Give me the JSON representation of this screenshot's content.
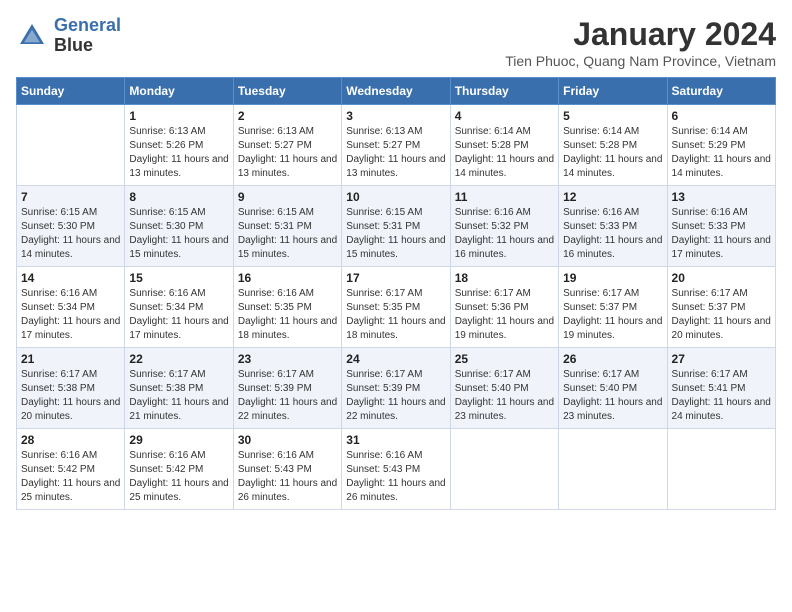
{
  "header": {
    "logo_line1": "General",
    "logo_line2": "Blue",
    "title": "January 2024",
    "subtitle": "Tien Phuoc, Quang Nam Province, Vietnam"
  },
  "calendar": {
    "weekdays": [
      "Sunday",
      "Monday",
      "Tuesday",
      "Wednesday",
      "Thursday",
      "Friday",
      "Saturday"
    ],
    "weeks": [
      [
        {
          "day": "",
          "sunrise": "",
          "sunset": "",
          "daylight": ""
        },
        {
          "day": "1",
          "sunrise": "Sunrise: 6:13 AM",
          "sunset": "Sunset: 5:26 PM",
          "daylight": "Daylight: 11 hours and 13 minutes."
        },
        {
          "day": "2",
          "sunrise": "Sunrise: 6:13 AM",
          "sunset": "Sunset: 5:27 PM",
          "daylight": "Daylight: 11 hours and 13 minutes."
        },
        {
          "day": "3",
          "sunrise": "Sunrise: 6:13 AM",
          "sunset": "Sunset: 5:27 PM",
          "daylight": "Daylight: 11 hours and 13 minutes."
        },
        {
          "day": "4",
          "sunrise": "Sunrise: 6:14 AM",
          "sunset": "Sunset: 5:28 PM",
          "daylight": "Daylight: 11 hours and 14 minutes."
        },
        {
          "day": "5",
          "sunrise": "Sunrise: 6:14 AM",
          "sunset": "Sunset: 5:28 PM",
          "daylight": "Daylight: 11 hours and 14 minutes."
        },
        {
          "day": "6",
          "sunrise": "Sunrise: 6:14 AM",
          "sunset": "Sunset: 5:29 PM",
          "daylight": "Daylight: 11 hours and 14 minutes."
        }
      ],
      [
        {
          "day": "7",
          "sunrise": "Sunrise: 6:15 AM",
          "sunset": "Sunset: 5:30 PM",
          "daylight": "Daylight: 11 hours and 14 minutes."
        },
        {
          "day": "8",
          "sunrise": "Sunrise: 6:15 AM",
          "sunset": "Sunset: 5:30 PM",
          "daylight": "Daylight: 11 hours and 15 minutes."
        },
        {
          "day": "9",
          "sunrise": "Sunrise: 6:15 AM",
          "sunset": "Sunset: 5:31 PM",
          "daylight": "Daylight: 11 hours and 15 minutes."
        },
        {
          "day": "10",
          "sunrise": "Sunrise: 6:15 AM",
          "sunset": "Sunset: 5:31 PM",
          "daylight": "Daylight: 11 hours and 15 minutes."
        },
        {
          "day": "11",
          "sunrise": "Sunrise: 6:16 AM",
          "sunset": "Sunset: 5:32 PM",
          "daylight": "Daylight: 11 hours and 16 minutes."
        },
        {
          "day": "12",
          "sunrise": "Sunrise: 6:16 AM",
          "sunset": "Sunset: 5:33 PM",
          "daylight": "Daylight: 11 hours and 16 minutes."
        },
        {
          "day": "13",
          "sunrise": "Sunrise: 6:16 AM",
          "sunset": "Sunset: 5:33 PM",
          "daylight": "Daylight: 11 hours and 17 minutes."
        }
      ],
      [
        {
          "day": "14",
          "sunrise": "Sunrise: 6:16 AM",
          "sunset": "Sunset: 5:34 PM",
          "daylight": "Daylight: 11 hours and 17 minutes."
        },
        {
          "day": "15",
          "sunrise": "Sunrise: 6:16 AM",
          "sunset": "Sunset: 5:34 PM",
          "daylight": "Daylight: 11 hours and 17 minutes."
        },
        {
          "day": "16",
          "sunrise": "Sunrise: 6:16 AM",
          "sunset": "Sunset: 5:35 PM",
          "daylight": "Daylight: 11 hours and 18 minutes."
        },
        {
          "day": "17",
          "sunrise": "Sunrise: 6:17 AM",
          "sunset": "Sunset: 5:35 PM",
          "daylight": "Daylight: 11 hours and 18 minutes."
        },
        {
          "day": "18",
          "sunrise": "Sunrise: 6:17 AM",
          "sunset": "Sunset: 5:36 PM",
          "daylight": "Daylight: 11 hours and 19 minutes."
        },
        {
          "day": "19",
          "sunrise": "Sunrise: 6:17 AM",
          "sunset": "Sunset: 5:37 PM",
          "daylight": "Daylight: 11 hours and 19 minutes."
        },
        {
          "day": "20",
          "sunrise": "Sunrise: 6:17 AM",
          "sunset": "Sunset: 5:37 PM",
          "daylight": "Daylight: 11 hours and 20 minutes."
        }
      ],
      [
        {
          "day": "21",
          "sunrise": "Sunrise: 6:17 AM",
          "sunset": "Sunset: 5:38 PM",
          "daylight": "Daylight: 11 hours and 20 minutes."
        },
        {
          "day": "22",
          "sunrise": "Sunrise: 6:17 AM",
          "sunset": "Sunset: 5:38 PM",
          "daylight": "Daylight: 11 hours and 21 minutes."
        },
        {
          "day": "23",
          "sunrise": "Sunrise: 6:17 AM",
          "sunset": "Sunset: 5:39 PM",
          "daylight": "Daylight: 11 hours and 22 minutes."
        },
        {
          "day": "24",
          "sunrise": "Sunrise: 6:17 AM",
          "sunset": "Sunset: 5:39 PM",
          "daylight": "Daylight: 11 hours and 22 minutes."
        },
        {
          "day": "25",
          "sunrise": "Sunrise: 6:17 AM",
          "sunset": "Sunset: 5:40 PM",
          "daylight": "Daylight: 11 hours and 23 minutes."
        },
        {
          "day": "26",
          "sunrise": "Sunrise: 6:17 AM",
          "sunset": "Sunset: 5:40 PM",
          "daylight": "Daylight: 11 hours and 23 minutes."
        },
        {
          "day": "27",
          "sunrise": "Sunrise: 6:17 AM",
          "sunset": "Sunset: 5:41 PM",
          "daylight": "Daylight: 11 hours and 24 minutes."
        }
      ],
      [
        {
          "day": "28",
          "sunrise": "Sunrise: 6:16 AM",
          "sunset": "Sunset: 5:42 PM",
          "daylight": "Daylight: 11 hours and 25 minutes."
        },
        {
          "day": "29",
          "sunrise": "Sunrise: 6:16 AM",
          "sunset": "Sunset: 5:42 PM",
          "daylight": "Daylight: 11 hours and 25 minutes."
        },
        {
          "day": "30",
          "sunrise": "Sunrise: 6:16 AM",
          "sunset": "Sunset: 5:43 PM",
          "daylight": "Daylight: 11 hours and 26 minutes."
        },
        {
          "day": "31",
          "sunrise": "Sunrise: 6:16 AM",
          "sunset": "Sunset: 5:43 PM",
          "daylight": "Daylight: 11 hours and 26 minutes."
        },
        {
          "day": "",
          "sunrise": "",
          "sunset": "",
          "daylight": ""
        },
        {
          "day": "",
          "sunrise": "",
          "sunset": "",
          "daylight": ""
        },
        {
          "day": "",
          "sunrise": "",
          "sunset": "",
          "daylight": ""
        }
      ]
    ]
  }
}
